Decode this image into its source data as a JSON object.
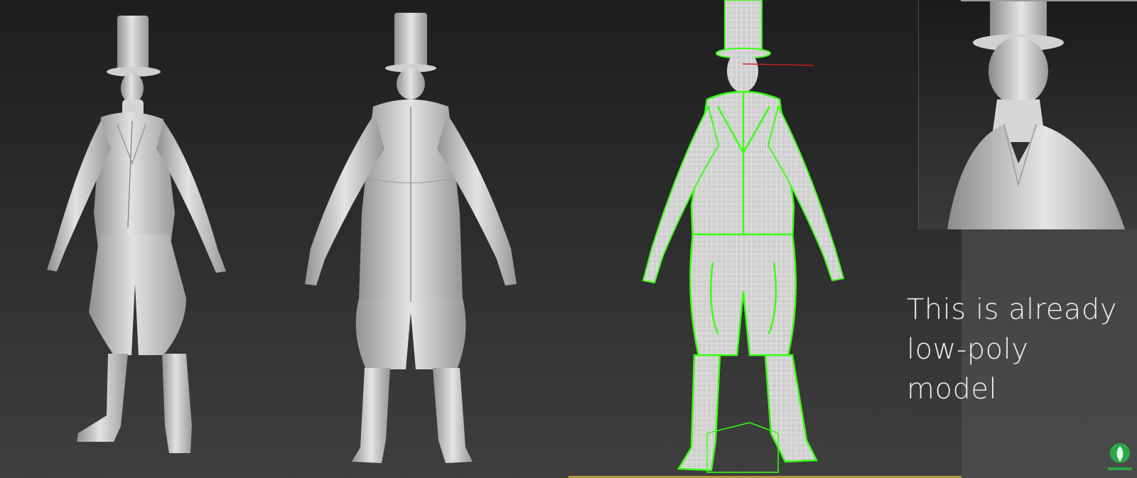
{
  "caption": {
    "text": "This is already\nlow-poly\nmodel"
  },
  "viewports": [
    {
      "id": "front",
      "view": "3/4 front shaded"
    },
    {
      "id": "back",
      "view": "back shaded"
    },
    {
      "id": "wire",
      "view": "front wireframe with seams"
    },
    {
      "id": "close",
      "view": "head close-up"
    }
  ],
  "colors": {
    "background": "#1c1c1c",
    "model": "#d9d9d9",
    "wire": "#ffffff",
    "seam": "#39ff14",
    "gizmo": "#c81e1e"
  },
  "brand_icon": "leaf-logo-icon"
}
